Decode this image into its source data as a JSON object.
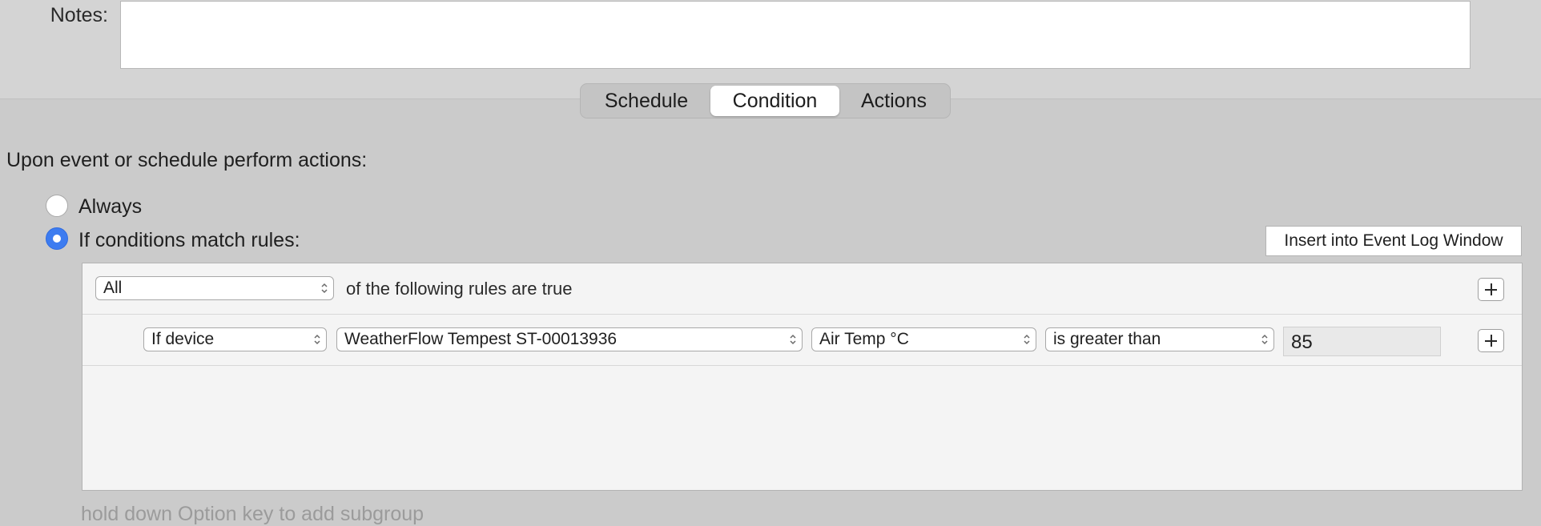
{
  "notes": {
    "label": "Notes:",
    "value": ""
  },
  "tabs": [
    {
      "label": "Schedule",
      "selected": false
    },
    {
      "label": "Condition",
      "selected": true
    },
    {
      "label": "Actions",
      "selected": false
    }
  ],
  "condition": {
    "heading": "Upon event or schedule perform actions:",
    "options": [
      {
        "label": "Always",
        "selected": false
      },
      {
        "label": "If conditions match rules:",
        "selected": true
      }
    ],
    "insert_button_label": "Insert into Event Log Window",
    "rules": {
      "match_select": "All",
      "match_suffix": "of the following rules are true",
      "rows": [
        {
          "type_select": "If device",
          "device_select": "WeatherFlow Tempest ST-00013936",
          "state_select": "Air Temp °C",
          "operator_select": "is greater than",
          "value": "85"
        }
      ]
    },
    "hint": "hold down Option key to add subgroup"
  },
  "colors": {
    "accent": "#3d7cf0",
    "window_bg": "#cbcbcb",
    "panel_bg": "#f4f4f4"
  }
}
